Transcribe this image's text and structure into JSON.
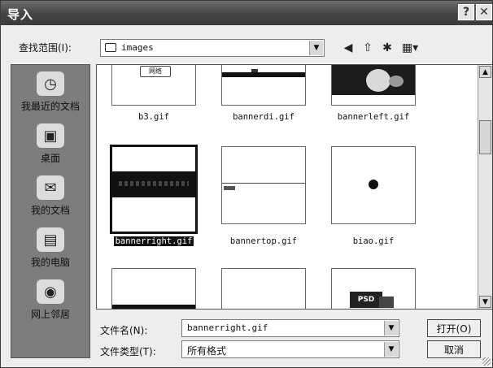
{
  "window": {
    "title": "导入"
  },
  "titlebar": {
    "help_glyph": "?",
    "close_glyph": "✕"
  },
  "lookin": {
    "label": "查找范围(I):",
    "value": "images"
  },
  "toolbar": {
    "back_glyph": "◀",
    "up_glyph": "⇧",
    "newfolder_glyph": "✱",
    "views_glyph": "▦▾"
  },
  "places": [
    {
      "label": "我最近的文档",
      "glyph": "◷"
    },
    {
      "label": "桌面",
      "glyph": "▣"
    },
    {
      "label": "我的文档",
      "glyph": "✉"
    },
    {
      "label": "我的电脑",
      "glyph": "▤"
    },
    {
      "label": "网上邻居",
      "glyph": "◉"
    }
  ],
  "files": [
    {
      "name": "b3.gif"
    },
    {
      "name": "bannerdi.gif"
    },
    {
      "name": "bannerleft.gif"
    },
    {
      "name": "bannerright.gif",
      "selected": true
    },
    {
      "name": "bannertop.gif"
    },
    {
      "name": "biao.gif"
    },
    {
      "name": ""
    },
    {
      "name": ""
    },
    {
      "name": ""
    }
  ],
  "thumb_text": {
    "b3_logo": "网络",
    "psd_badge": "PSD"
  },
  "filename": {
    "label": "文件名(N):",
    "value": "bannerright.gif"
  },
  "filetype": {
    "label": "文件类型(T):",
    "value": "所有格式"
  },
  "buttons": {
    "open": "打开(O)",
    "cancel": "取消"
  }
}
